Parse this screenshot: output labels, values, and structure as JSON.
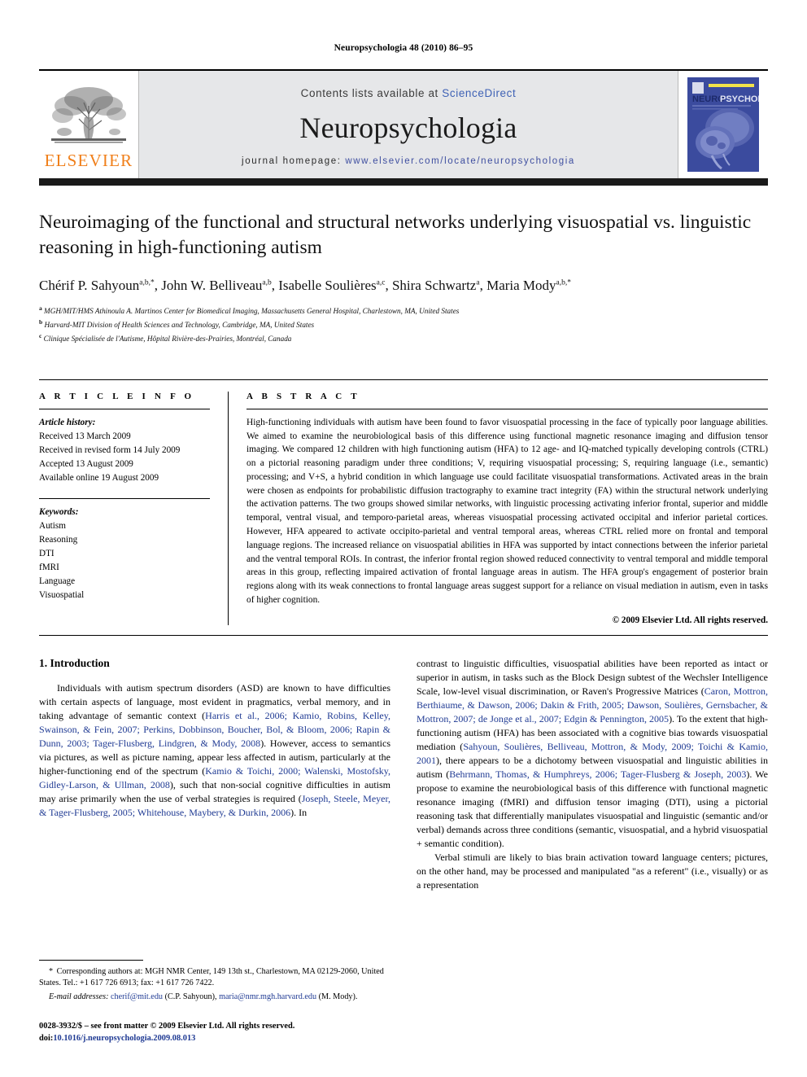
{
  "running_head": "Neuropsychologia 48 (2010) 86–95",
  "masthead": {
    "contents_prefix": "Contents lists available at ",
    "sciencedirect": "ScienceDirect",
    "journal_name": "Neuropsychologia",
    "homepage_label": "journal homepage:",
    "homepage_url": "www.elsevier.com/locate/neuropsychologia",
    "publisher_wordmark": "ELSEVIER",
    "publisher_color": "#f07f1a",
    "link_color": "#3f62b5",
    "cover_title_dark": "NEURO",
    "cover_title_light": "PSYCHOLOGIA",
    "cover_bg": "#3b4b9e"
  },
  "title": "Neuroimaging of the functional and structural networks underlying visuospatial vs. linguistic reasoning in high-functioning autism",
  "authors": [
    {
      "name": "Chérif P. Sahyoun",
      "sup": "a,b,*"
    },
    {
      "name": "John W. Belliveau",
      "sup": "a,b"
    },
    {
      "name": "Isabelle Soulières",
      "sup": "a,c"
    },
    {
      "name": "Shira Schwartz",
      "sup": "a"
    },
    {
      "name": "Maria Mody",
      "sup": "a,b,*"
    }
  ],
  "affiliations": [
    {
      "marker": "a",
      "text": "MGH/MIT/HMS Athinoula A. Martinos Center for Biomedical Imaging, Massachusetts General Hospital, Charlestown, MA, United States"
    },
    {
      "marker": "b",
      "text": "Harvard-MIT Division of Health Sciences and Technology, Cambridge, MA, United States"
    },
    {
      "marker": "c",
      "text": "Clinique Spécialisée de l'Autisme, Hôpital Rivière-des-Prairies, Montréal, Canada"
    }
  ],
  "article_info": {
    "heading": "A R T I C L E   I N F O",
    "history_label": "Article history:",
    "history": [
      "Received 13 March 2009",
      "Received in revised form 14 July 2009",
      "Accepted 13 August 2009",
      "Available online 19 August 2009"
    ],
    "keywords_label": "Keywords:",
    "keywords": [
      "Autism",
      "Reasoning",
      "DTI",
      "fMRI",
      "Language",
      "Visuospatial"
    ]
  },
  "abstract": {
    "heading": "A B S T R A C T",
    "text": "High-functioning individuals with autism have been found to favor visuospatial processing in the face of typically poor language abilities. We aimed to examine the neurobiological basis of this difference using functional magnetic resonance imaging and diffusion tensor imaging. We compared 12 children with high functioning autism (HFA) to 12 age- and IQ-matched typically developing controls (CTRL) on a pictorial reasoning paradigm under three conditions; V, requiring visuospatial processing; S, requiring language (i.e., semantic) processing; and V+S, a hybrid condition in which language use could facilitate visuospatial transformations. Activated areas in the brain were chosen as endpoints for probabilistic diffusion tractography to examine tract integrity (FA) within the structural network underlying the activation patterns. The two groups showed similar networks, with linguistic processing activating inferior frontal, superior and middle temporal, ventral visual, and temporo-parietal areas, whereas visuospatial processing activated occipital and inferior parietal cortices. However, HFA appeared to activate occipito-parietal and ventral temporal areas, whereas CTRL relied more on frontal and temporal language regions. The increased reliance on visuospatial abilities in HFA was supported by intact connections between the inferior parietal and the ventral temporal ROIs. In contrast, the inferior frontal region showed reduced connectivity to ventral temporal and middle temporal areas in this group, reflecting impaired activation of frontal language areas in autism. The HFA group's engagement of posterior brain regions along with its weak connections to frontal language areas suggest support for a reliance on visual mediation in autism, even in tasks of higher cognition.",
    "copyright": "© 2009 Elsevier Ltd. All rights reserved."
  },
  "introduction": {
    "heading": "1. Introduction",
    "left_para1_plain_a": "Individuals with autism spectrum disorders (ASD) are known to have difficulties with certain aspects of language, most evident in pragmatics, verbal memory, and in taking advantage of semantic context (",
    "left_para1_refs_a": "Harris et al., 2006; Kamio, Robins, Kelley, Swainson, & Fein, 2007; Perkins, Dobbinson, Boucher, Bol, & Bloom, 2006; Rapin & Dunn, 2003; Tager-Flusberg, Lindgren, & Mody, 2008",
    "left_para1_plain_b": "). However, access to semantics via pictures, as well as picture naming, appear less affected in autism, particularly at the higher-functioning end of the spectrum (",
    "left_para1_refs_b": "Kamio & Toichi, 2000; Walenski, Mostofsky, Gidley-Larson, & Ullman, 2008",
    "left_para1_plain_c": "), such that non-social cognitive difficulties in autism may arise primarily when the use of verbal strategies is required (",
    "left_para1_refs_c": "Joseph, Steele, Meyer, & Tager-Flusberg, 2005; Whitehouse, Maybery, & Durkin, 2006",
    "left_para1_plain_d": "). In",
    "right_para1_plain_a": "contrast to linguistic difficulties, visuospatial abilities have been reported as intact or superior in autism, in tasks such as the Block Design subtest of the Wechsler Intelligence Scale, low-level visual discrimination, or Raven's Progressive Matrices (",
    "right_para1_refs_a": "Caron, Mottron, Berthiaume, & Dawson, 2006; Dakin & Frith, 2005; Dawson, Soulières, Gernsbacher, & Mottron, 2007; de Jonge et al., 2007; Edgin & Pennington, 2005",
    "right_para1_plain_b": "). To the extent that high-functioning autism (HFA) has been associated with a cognitive bias towards visuospatial mediation (",
    "right_para1_refs_b": "Sahyoun, Soulières, Belliveau, Mottron, & Mody, 2009; Toichi & Kamio, 2001",
    "right_para1_plain_c": "), there appears to be a dichotomy between visuospatial and linguistic abilities in autism (",
    "right_para1_refs_c": "Behrmann, Thomas, & Humphreys, 2006; Tager-Flusberg & Joseph, 2003",
    "right_para1_plain_d": "). We propose to examine the neurobiological basis of this difference with functional magnetic resonance imaging (fMRI) and diffusion tensor imaging (DTI), using a pictorial reasoning task that differentially manipulates visuospatial and linguistic (semantic and/or verbal) demands across three conditions (semantic, visuospatial, and a hybrid visuospatial + semantic condition).",
    "right_para2": "Verbal stimuli are likely to bias brain activation toward language centers; pictures, on the other hand, may be processed and manipulated \"as a referent\" (i.e., visually) or as a representation"
  },
  "footnotes": {
    "corresponding": "Corresponding authors at: MGH NMR Center, 149 13th st., Charlestown, MA 02129-2060, United States. Tel.: +1 617 726 6913; fax: +1 617 726 7422.",
    "corresponding_star": "*",
    "email_label": "E-mail addresses:",
    "email1": "cherif@mit.edu",
    "email1_owner": "(C.P. Sahyoun),",
    "email2": "maria@nmr.mgh.harvard.edu",
    "email2_owner": "(M. Mody).",
    "issn_line": "0028-3932/$ – see front matter © 2009 Elsevier Ltd. All rights reserved.",
    "doi_prefix": "doi:",
    "doi": "10.1016/j.neuropsychologia.2009.08.013"
  }
}
